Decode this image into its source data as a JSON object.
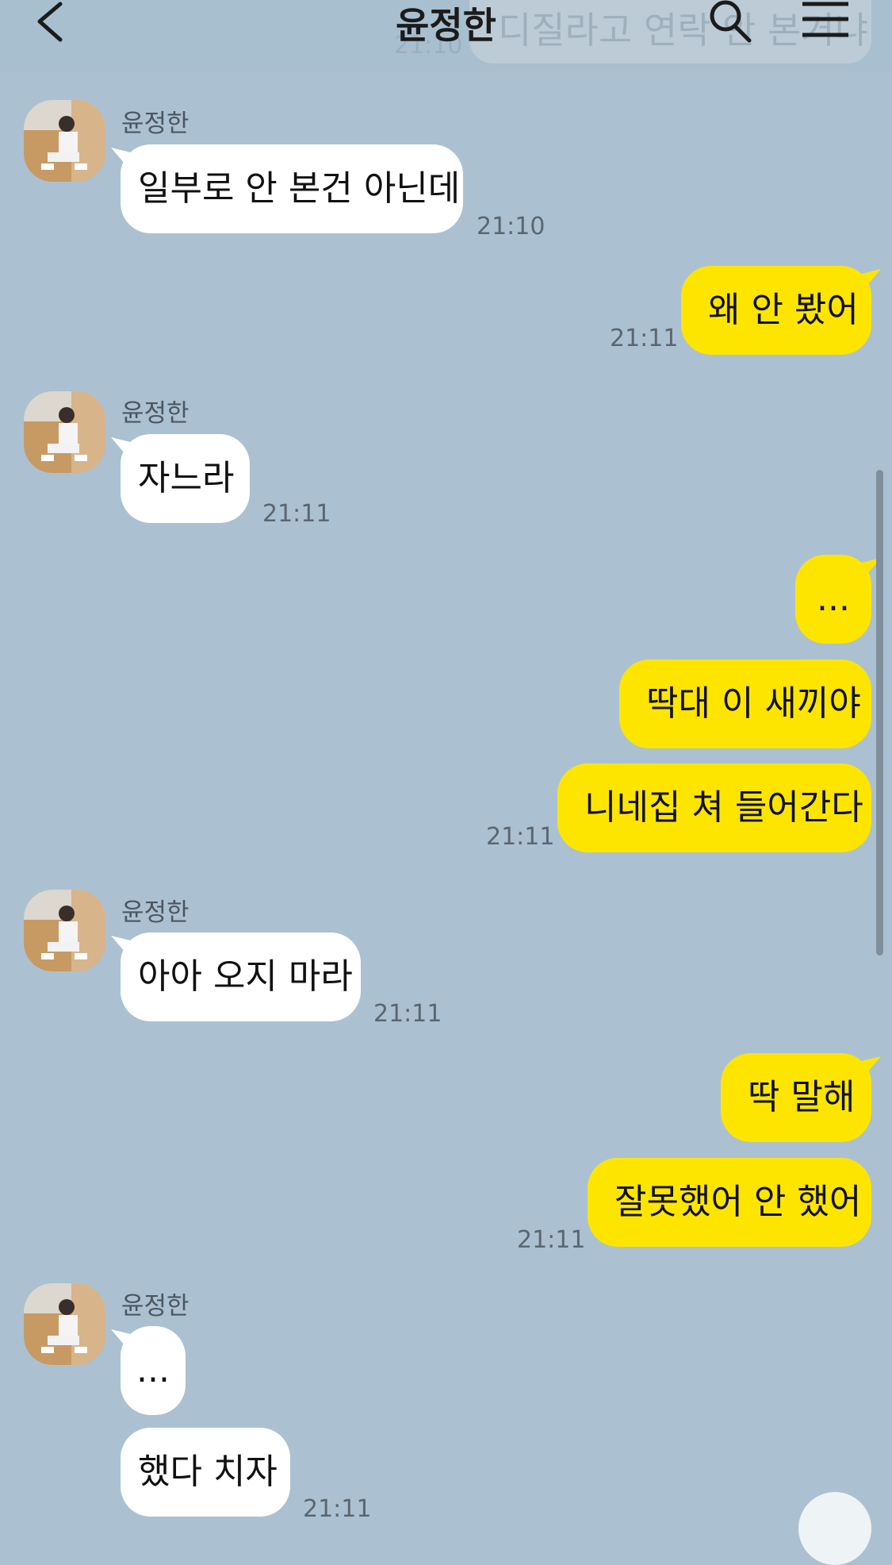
{
  "header": {
    "title": "윤정한",
    "back_icon": "chevron-left-icon",
    "search_icon": "search-icon",
    "menu_icon": "hamburger-menu-icon",
    "faded_message": "디질라고 연락 안 본거냐",
    "faded_time": "21:10"
  },
  "colors": {
    "background": "#abc1d1",
    "my_bubble": "#fee500",
    "their_bubble": "#ffffff"
  },
  "messages": [
    {
      "sender": "윤정한",
      "text": "일부로 안 본건 아닌데",
      "time": "21:10"
    },
    {
      "text": "왜 안 봤어",
      "time": "21:11"
    },
    {
      "sender": "윤정한",
      "text": "자느라",
      "time": "21:11"
    },
    {
      "text": "...",
      "time": ""
    },
    {
      "text": "딱대 이 새끼야",
      "time": ""
    },
    {
      "text": "니네집 쳐 들어간다",
      "time": "21:11"
    },
    {
      "sender": "윤정한",
      "text": "아아 오지 마라",
      "time": "21:11"
    },
    {
      "text": "딱 말해",
      "time": ""
    },
    {
      "text": "잘못했어 안 했어",
      "time": "21:11"
    },
    {
      "sender": "윤정한",
      "text": "...",
      "time": ""
    },
    {
      "text": "했다 치자",
      "time": "21:11"
    }
  ]
}
